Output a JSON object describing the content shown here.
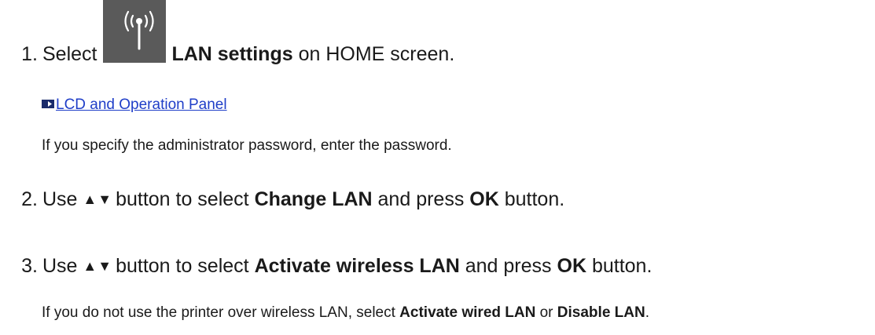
{
  "steps": [
    {
      "number": "1.",
      "text_before": "Select",
      "icon": "wireless-lan-settings-icon",
      "bold_1": "LAN settings",
      "text_after": "on HOME screen.",
      "link_text": "LCD and Operation Panel",
      "note": "If you specify the administrator password, enter the password."
    },
    {
      "number": "2.",
      "text_before": "Use",
      "arrows": "▲▼",
      "text_mid": "button to select",
      "bold_1": "Change LAN",
      "text_and": "and press",
      "bold_2": "OK",
      "text_after": "button."
    },
    {
      "number": "3.",
      "text_before": "Use",
      "arrows": "▲▼",
      "text_mid": "button to select",
      "bold_1": "Activate wireless LAN",
      "text_and": "and press",
      "bold_2": "OK",
      "text_after": "button.",
      "note_before": "If you do not use the printer over wireless LAN, select",
      "note_bold_1": "Activate wired LAN",
      "note_or": "or",
      "note_bold_2": "Disable LAN",
      "note_end": "."
    }
  ],
  "colors": {
    "link": "#1f3ec8",
    "icon_bg": "#5a5a5a",
    "text": "#1a1a1a"
  }
}
